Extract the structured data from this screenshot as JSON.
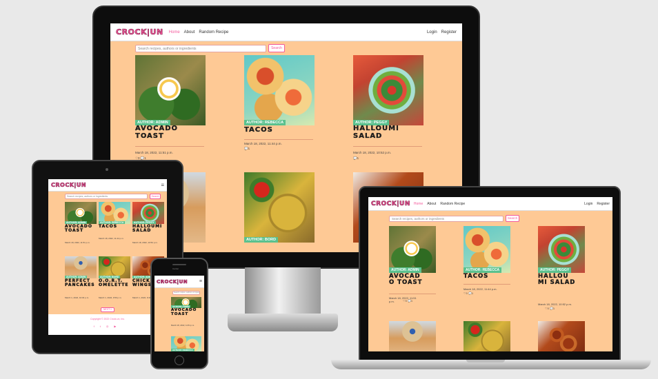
{
  "logo": "CROCK|UN",
  "nav": {
    "links": [
      "Home",
      "About",
      "Random Recipe"
    ],
    "login": "Login",
    "register": "Register",
    "hamburger": "≡"
  },
  "search": {
    "placeholder": "Search recipes, authors or ingredients",
    "button": "Search"
  },
  "recipes": [
    {
      "title": "AVOCADO TOAST",
      "author": "AUTHOR: ADMIN",
      "date": "March 18, 2022, 11:51 p.m.",
      "likes": "0",
      "comments": "1"
    },
    {
      "title": "TACOS",
      "author": "AUTHOR: REBECCA",
      "date": "March 18, 2022, 11:44 p.m.",
      "likes": "0",
      "comments": "1"
    },
    {
      "title": "HALLOUMI SALAD",
      "author": "AUTHOR: PEGGY",
      "date": "March 18, 2022, 10:52 p.m.",
      "likes": "0",
      "comments": "1"
    },
    {
      "title": "PERFECT PANCAKES",
      "author": "AUTHOR: ADMIN",
      "date": "March 1, 2022, 10:04 p.m.",
      "likes": "0",
      "comments": "1"
    },
    {
      "title": "O.O.R.T. OMELETTE",
      "author": "AUTHOR: BORD",
      "date": "March 1, 2022, 9:50 p.m.",
      "likes": "0",
      "comments": "1"
    },
    {
      "title": "CHICKEN WINGS",
      "author": "AUTHOR: ADMIN",
      "date": "March 1, 2022, 9:40 p.m.",
      "likes": "0",
      "comments": "1"
    }
  ],
  "laptop": {
    "title_avocado": "AVOCAD O TOAST",
    "title_salad": "HALLOU MI SALAD",
    "date_avocado": "March 18, 2022, 11:51 p.m.",
    "date_salad": "March 18, 2022, 10:52 p.m."
  },
  "pagination": "NEXT »",
  "footer": "Copyright © 2022 Crock-un, Inc.",
  "phone_carrier": "Carrier"
}
